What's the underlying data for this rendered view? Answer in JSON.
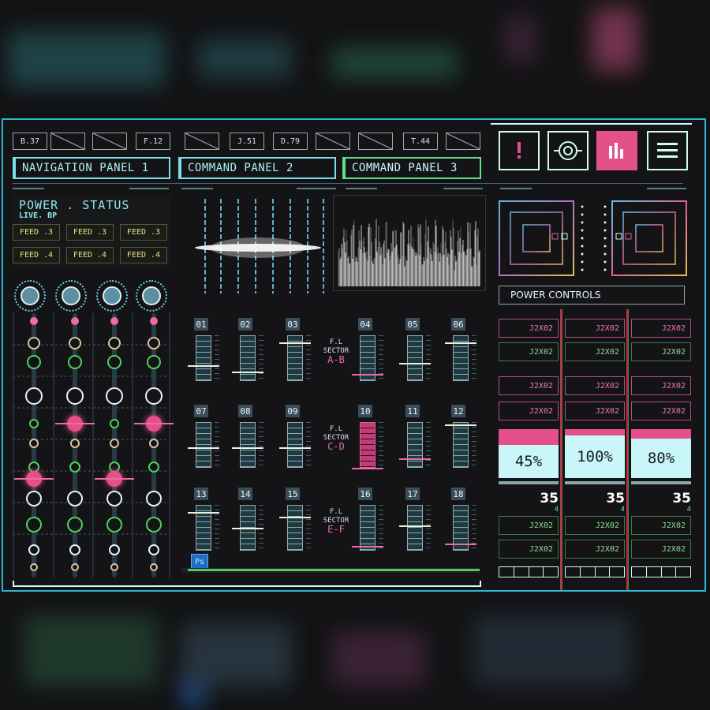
{
  "top_chips": [
    "B.37",
    "",
    "",
    "F.12",
    "",
    "J.51",
    "D.79",
    "",
    "",
    "T.44",
    ""
  ],
  "nav": {
    "panel1": "NAVIGATION PANEL 1",
    "panel2": "COMMAND PANEL 2",
    "panel3": "COMMAND PANEL 3",
    "active": "panel3"
  },
  "icons": [
    "alert-icon",
    "target-icon",
    "bar-chart-icon",
    "menu-icon"
  ],
  "power_status": {
    "title": "POWER . STATUS",
    "subtitle": "LIVE. BP",
    "feeds": [
      "FEED .3",
      "FEED .3",
      "FEED .3",
      "FEED .4",
      "FEED .4",
      "FEED .4"
    ]
  },
  "faders": {
    "labels": [
      "01",
      "02",
      "03",
      "04",
      "05",
      "06",
      "07",
      "08",
      "09",
      "10",
      "11",
      "12",
      "13",
      "14",
      "15",
      "16",
      "17",
      "18"
    ],
    "levels": [
      0.35,
      0.2,
      0.85,
      0.15,
      0.4,
      0.85,
      0.45,
      0.45,
      0.45,
      0.0,
      0.2,
      0.95,
      0.85,
      0.5,
      0.75,
      0.1,
      0.55,
      0.15
    ],
    "sectors": [
      {
        "label": "F.L",
        "title": "SECTOR",
        "code": "A-B"
      },
      {
        "label": "F.L",
        "title": "SECTOR",
        "code": "C-D"
      },
      {
        "label": "F.L",
        "title": "SECTOR",
        "code": "E-F"
      }
    ],
    "ps_badge": "Ps"
  },
  "power_controls": {
    "title": "POWER CONTROLS",
    "button_label": "J2X02",
    "columns": [
      {
        "percent": "45%",
        "level": 0.45,
        "value": "35",
        "sub": "4"
      },
      {
        "percent": "100%",
        "level": 1.0,
        "value": "35",
        "sub": "4"
      },
      {
        "percent": "80%",
        "level": 0.8,
        "value": "35",
        "sub": "4"
      }
    ]
  },
  "colors": {
    "accent_cyan": "#2bb7d2",
    "accent_pink": "#e4508a",
    "accent_green": "#5fe08a",
    "accent_yellow": "#e6e08a"
  }
}
